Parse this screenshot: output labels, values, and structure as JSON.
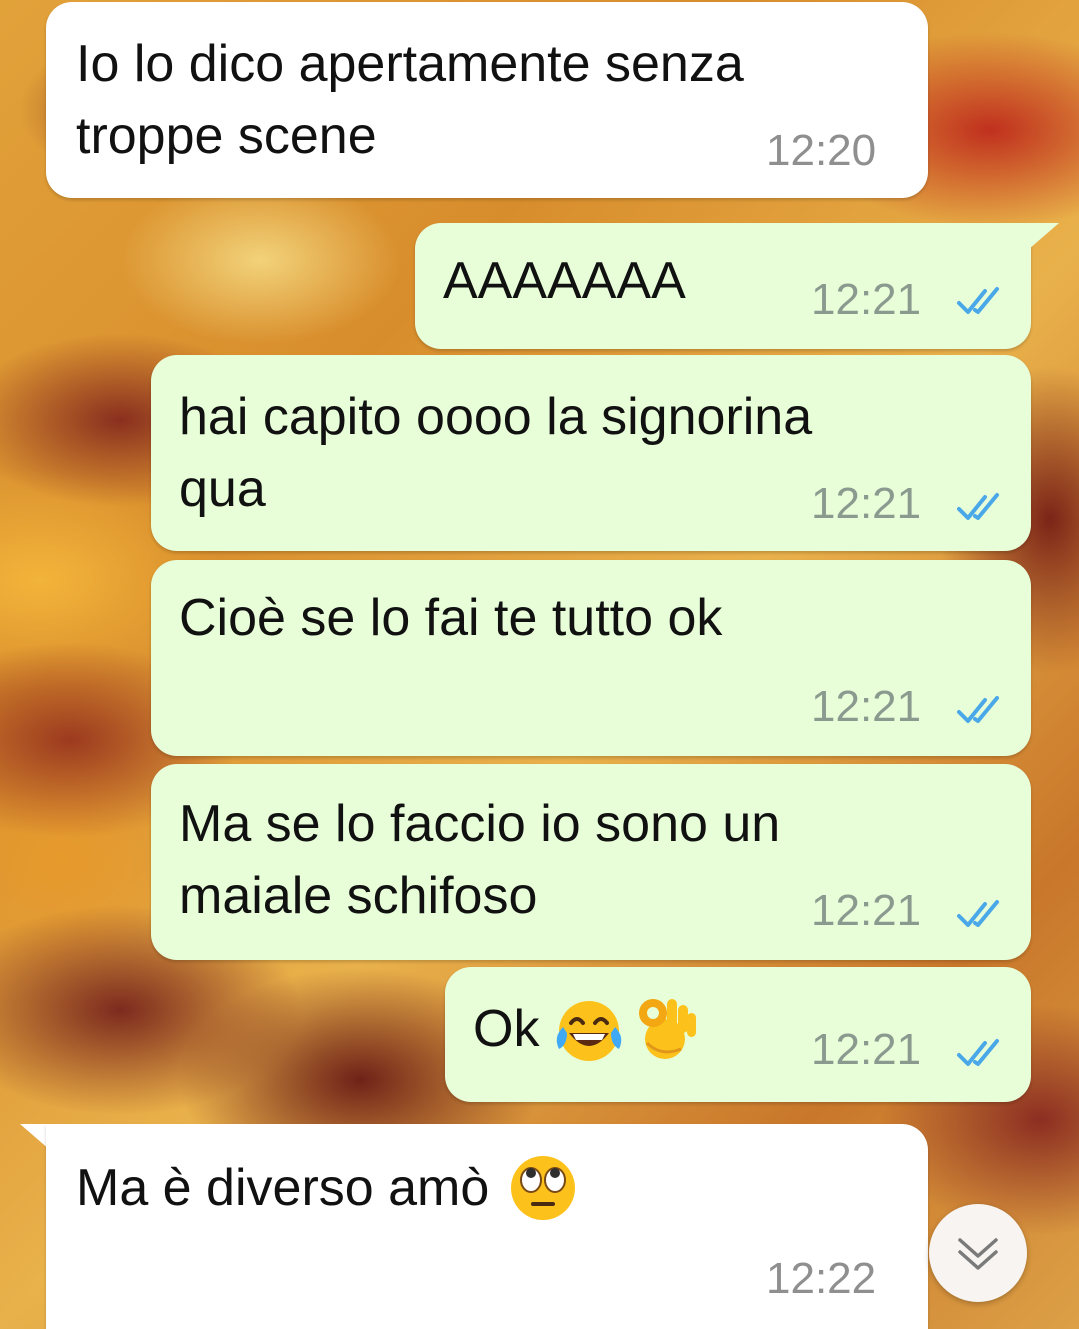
{
  "messages": [
    {
      "direction": "incoming",
      "text": "Io lo dico apertamente senza\ntroppe scene",
      "time": "12:20"
    },
    {
      "direction": "outgoing",
      "text": "AAAAAAA",
      "time": "12:21",
      "status": "read"
    },
    {
      "direction": "outgoing",
      "text": "hai capito oooo la signorina\nqua",
      "time": "12:21",
      "status": "read"
    },
    {
      "direction": "outgoing",
      "text": "Cioè se lo fai te tutto ok",
      "time": "12:21",
      "status": "read"
    },
    {
      "direction": "outgoing",
      "text": "Ma se lo faccio io sono un\nmaiale schifoso",
      "time": "12:21",
      "status": "read"
    },
    {
      "direction": "outgoing",
      "text": "Ok",
      "emojis": [
        "face-with-tears-of-joy",
        "ok-hand"
      ],
      "time": "12:21",
      "status": "read"
    },
    {
      "direction": "incoming",
      "text": "Ma è diverso amò",
      "emojis": [
        "face-with-rolling-eyes"
      ],
      "time": "12:22"
    }
  ],
  "colors": {
    "incoming_bubble": "#ffffff",
    "outgoing_bubble": "#e7fed8",
    "read_ticks": "#4aa8e8",
    "timestamp": "#8b9a8f"
  },
  "icons": {
    "read_status": "double-check-icon",
    "scroll_down": "chevron-double-down-icon"
  }
}
